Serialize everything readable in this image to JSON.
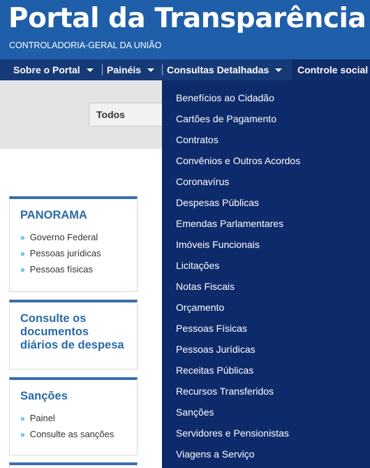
{
  "header": {
    "title": "Portal da Transparência",
    "subtitle": "CONTROLADORIA-GERAL DA UNIÃO"
  },
  "nav": {
    "items": [
      "Sobre o Portal",
      "Painéis",
      "Consultas Detalhadas",
      "Controle social"
    ]
  },
  "filter": {
    "selected": "Todos"
  },
  "cards": {
    "panorama": {
      "title": "PANORAMA",
      "links": [
        "Governo Federal",
        "Pessoas jurídicas",
        "Pessoas físicas"
      ]
    },
    "documentos": {
      "title_lines": [
        "Consulte os",
        "documentos",
        "diários de despesa"
      ]
    },
    "sancoes": {
      "title": "Sanções",
      "links": [
        "Painel",
        "Consulte as sanções"
      ]
    }
  },
  "dropdown": {
    "items": [
      "Benefícios ao Cidadão",
      "Cartões de Pagamento",
      "Contratos",
      "Convênios e Outros Acordos",
      "Coronavírus",
      "Despesas Públicas",
      "Emendas Parlamentares",
      "Imóveis Funcionais",
      "Licitações",
      "Notas Fiscais",
      "Orçamento",
      "Pessoas Físicas",
      "Pessoas Jurídicas",
      "Receitas Públicas",
      "Recursos Transferidos",
      "Sanções",
      "Servidores e Pensionistas",
      "Viagens a Serviço"
    ]
  },
  "colors": {
    "header_bg": "#1f5ea8",
    "navbar_bg": "#163a78",
    "dropdown_bg": "#0d2b6b",
    "card_title": "#2a6aa8",
    "chevron": "#2aa0d6"
  }
}
